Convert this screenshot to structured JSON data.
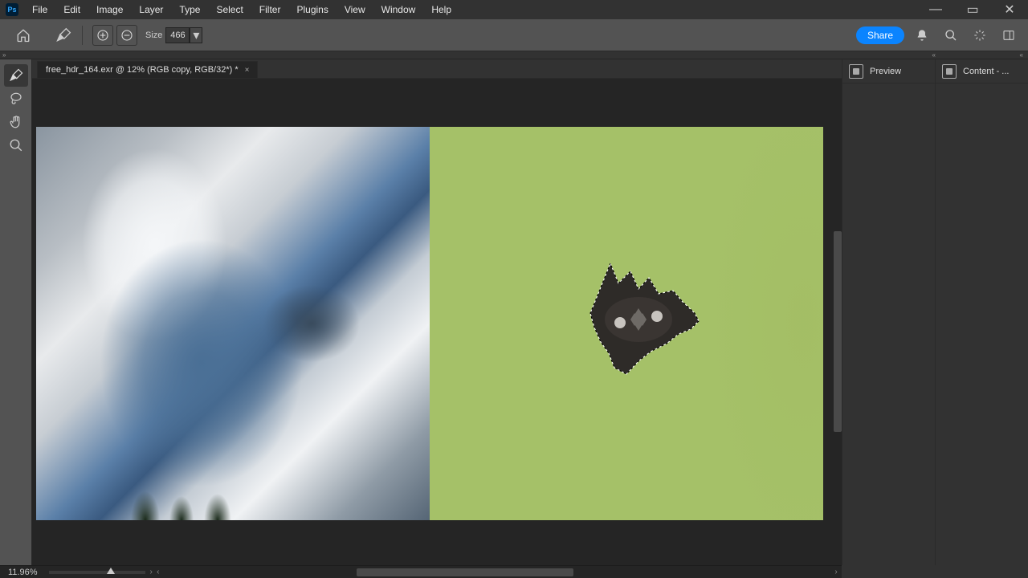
{
  "app": {
    "short": "Ps"
  },
  "menu": {
    "items": [
      "File",
      "Edit",
      "Image",
      "Layer",
      "Type",
      "Select",
      "Filter",
      "Plugins",
      "View",
      "Window",
      "Help"
    ]
  },
  "options": {
    "size_label": "Size",
    "size_value": "466",
    "share_label": "Share"
  },
  "tab": {
    "label": "free_hdr_164.exr @ 12% (RGB copy, RGB/32*) *",
    "close": "×"
  },
  "panels": {
    "preview": "Preview",
    "content": "Content - ..."
  },
  "status": {
    "zoom": "11.96%"
  },
  "icons": {
    "minimize": "—",
    "maximize": "▭",
    "close": "✕",
    "home": "⌂",
    "brush": "✎",
    "add": "⊕",
    "subtract": "⊖",
    "dd": "▾",
    "bell": "🔔",
    "search": "🔍",
    "tips": "✦",
    "workspace": "◧",
    "lasso": "◯",
    "hand": "✋",
    "zoom": "🔍",
    "chev_expand": "»",
    "chev_collapse": "«",
    "chev_r": "›",
    "chev_l": "‹"
  }
}
